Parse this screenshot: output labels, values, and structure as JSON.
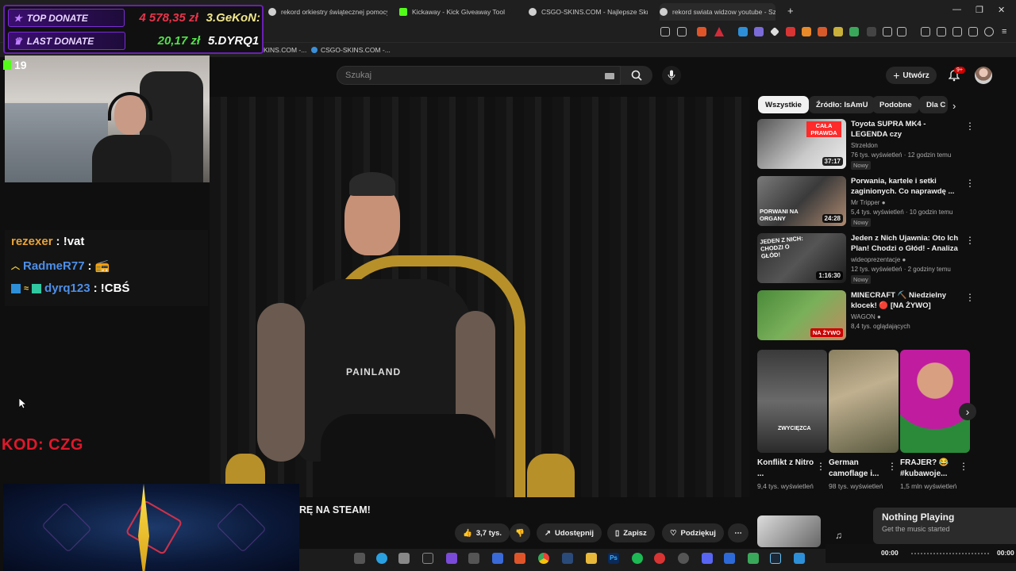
{
  "browser": {
    "tabs": [
      {
        "label": "rekord orkiestry świątecznej pomocy",
        "color": "#cfcfcf"
      },
      {
        "label": "Kickaway - Kick Giveaway Tool",
        "color": "#53fc18"
      },
      {
        "label": "CSGO-SKINS.COM - Najlepsze Skrzy",
        "color": "#cfcfcf"
      },
      {
        "label": "rekord swiata widzow youtube - Szu",
        "color": "#cfcfcf"
      }
    ],
    "new_tab": "+",
    "bookmarks": [
      "KINS.COM -...",
      "CSGO-SKINS.COM -..."
    ],
    "window_controls": [
      "—",
      "❐",
      "✕"
    ]
  },
  "youtube": {
    "search_placeholder": "Szukaj",
    "create_label": "Utwórz",
    "notif_count": "9+",
    "chips": [
      "Wszystkie",
      "Źródło: IsAmU",
      "Podobne",
      "Dla C"
    ],
    "recommendations": [
      {
        "title": "Toyota SUPRA MK4 - LEGENDA czy PRZEREKLAMOWANY Mit?",
        "channel": "Strzeldon",
        "meta": "76 tys. wyświetleń · 12 godzin temu",
        "badge": "Nowy",
        "duration": "37:17",
        "thumb_text": "CAŁA PRAWDA"
      },
      {
        "title": "Porwania, kartele i setki zaginionych. Co naprawdę ...",
        "channel": "Mr Tripper",
        "meta": "5,4 tys. wyświetleń · 10 godzin temu",
        "badge": "Nowy",
        "duration": "24:28",
        "thumb_text": "PORWANI NA ORGANY"
      },
      {
        "title": "Jeden z Nich Ujawnia: Oto Ich Plan! Chodzi o Głód! - Analiza ...",
        "channel": "wideoprezentacje",
        "meta": "12 tys. wyświetleń · 2 godziny temu",
        "badge": "Nowy",
        "duration": "1:16:30",
        "thumb_text": "JEDEN Z NICH: CHODZI O GŁÓD!"
      },
      {
        "title": "MINECRAFT ⛏️ Niedzielny klocek! 🔴 [NA ŻYWO]",
        "channel": "WAGON",
        "meta": "8,4 tys. oglądających",
        "badge": "",
        "duration": "",
        "thumb_text": "NA ŻYWO"
      }
    ],
    "shorts": [
      {
        "title": "Konflikt z Nitro ...",
        "views": "9,4 tys. wyświetleń",
        "thumb_text": "ZWYCIĘZCA"
      },
      {
        "title": "German camoflage i...",
        "views": "98 tys. wyświetleń",
        "thumb_text": ""
      },
      {
        "title": "FRAJER? 😂 #kubawoje...",
        "views": "1,5 mln wyświetleń",
        "thumb_text": ""
      }
    ],
    "video_title": "RĘ NA STEAM!",
    "actions": {
      "likes": "3,7 tys.",
      "share": "Udostępnij",
      "save": "Zapisz",
      "thanks": "Podziękuj",
      "more": "⋯"
    }
  },
  "overlay": {
    "top_donate_label": "TOP DONATE",
    "top_donate_amount": "4 578,35 zł",
    "top_donate_name": "3.GeKoN:",
    "last_donate_label": "LAST DONATE",
    "last_donate_amount": "20,17 zł",
    "last_donate_name": "5.DYRQ1",
    "viewers": "19",
    "chat": [
      {
        "user": "rezexer",
        "msg": ": !vat",
        "color": "#e8a33a"
      },
      {
        "user": "RadmeR77",
        "msg": ": 📻",
        "color": "#4d8fe8"
      },
      {
        "user": "dyrq123",
        "msg": ": !CBŚ",
        "color": "#4d8fe8"
      }
    ],
    "code": "KOD: CZG"
  },
  "music": {
    "title": "Nothing Playing",
    "subtitle": "Get the music started",
    "time_start": "00:00",
    "time_end": "00:00"
  }
}
